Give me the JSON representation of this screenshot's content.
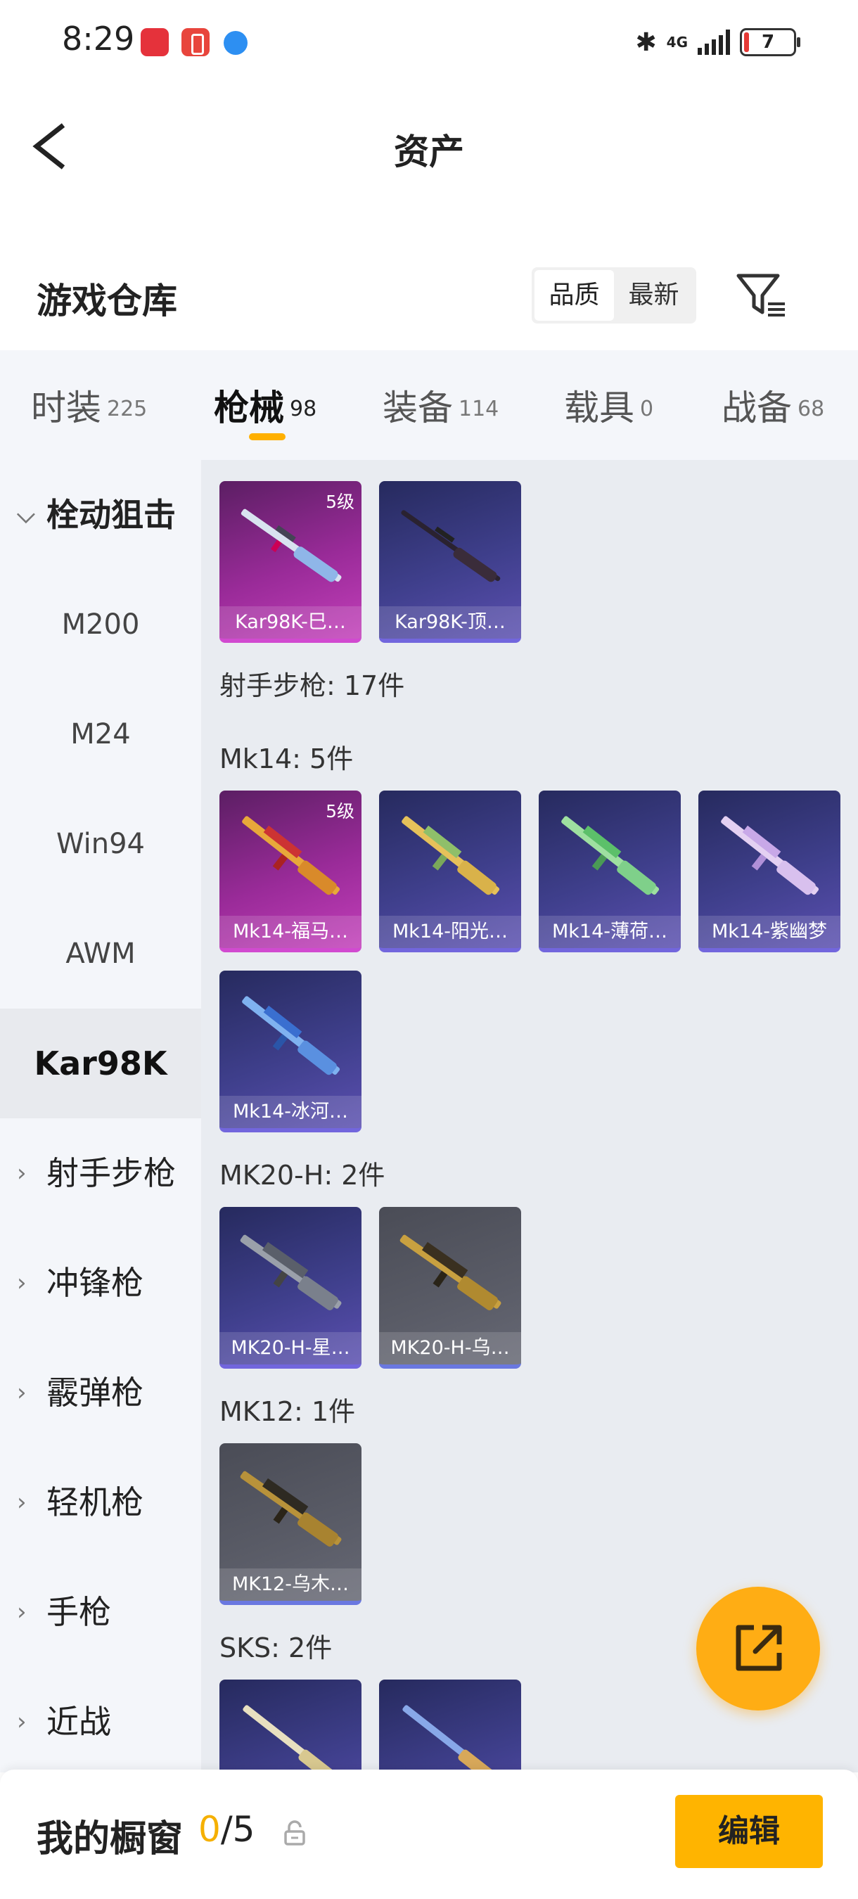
{
  "status_bar": {
    "time": "8:29",
    "network": "4G",
    "battery": "7"
  },
  "header": {
    "title": "资产"
  },
  "warehouse": {
    "title": "游戏仓库",
    "sort_options": [
      "品质",
      "最新"
    ],
    "active_sort": "品质"
  },
  "tabs": [
    {
      "label": "时装",
      "count": "225"
    },
    {
      "label": "枪械",
      "count": "98",
      "active": true
    },
    {
      "label": "装备",
      "count": "114"
    },
    {
      "label": "载具",
      "count": "0"
    },
    {
      "label": "战备",
      "count": "68"
    }
  ],
  "sidebar": {
    "items": [
      {
        "label": "栓动狙击",
        "kind": "category",
        "expanded": true
      },
      {
        "label": "M200",
        "kind": "sub"
      },
      {
        "label": "M24",
        "kind": "sub"
      },
      {
        "label": "Win94",
        "kind": "sub"
      },
      {
        "label": "AWM",
        "kind": "sub"
      },
      {
        "label": "Kar98K",
        "kind": "sub",
        "selected": true
      },
      {
        "label": "射手步枪",
        "kind": "category"
      },
      {
        "label": "冲锋枪",
        "kind": "category"
      },
      {
        "label": "霰弹枪",
        "kind": "category"
      },
      {
        "label": "轻机枪",
        "kind": "category"
      },
      {
        "label": "手枪",
        "kind": "category"
      },
      {
        "label": "近战",
        "kind": "category"
      }
    ]
  },
  "content": {
    "kar98k_cards": [
      {
        "name": "Kar98K-巳…",
        "level": "5级",
        "rarity": "pink"
      },
      {
        "name": "Kar98K-顶…",
        "level": "",
        "rarity": "purple"
      }
    ],
    "groups": [
      {
        "title": "射手步枪: 17件",
        "cards": []
      },
      {
        "title": "Mk14: 5件",
        "cards": [
          {
            "name": "Mk14-福马…",
            "level": "5级",
            "rarity": "pink"
          },
          {
            "name": "Mk14-阳光…",
            "level": "",
            "rarity": "purple"
          },
          {
            "name": "Mk14-薄荷…",
            "level": "",
            "rarity": "purple"
          },
          {
            "name": "Mk14-紫幽梦",
            "level": "",
            "rarity": "purple"
          },
          {
            "name": "Mk14-冰河…",
            "level": "",
            "rarity": "purple"
          }
        ]
      },
      {
        "title": "MK20-H: 2件",
        "cards": [
          {
            "name": "MK20-H-星…",
            "level": "",
            "rarity": "purple"
          },
          {
            "name": "MK20-H-乌…",
            "level": "",
            "rarity": "gray"
          }
        ]
      },
      {
        "title": "MK12: 1件",
        "cards": [
          {
            "name": "MK12-乌木…",
            "level": "",
            "rarity": "gray"
          }
        ]
      },
      {
        "title": "SKS: 2件",
        "cards": [
          {
            "name": "",
            "level": "",
            "rarity": "purple"
          },
          {
            "name": "",
            "level": "",
            "rarity": "purple"
          }
        ]
      }
    ]
  },
  "bottom_bar": {
    "title": "我的橱窗",
    "count_current": "0",
    "count_total": "/5",
    "edit_label": "编辑"
  },
  "icons": {
    "back": "chevron-left-icon",
    "filter": "filter-icon",
    "share": "share-external-icon",
    "lock": "lock-icon"
  },
  "colors": {
    "accent": "#ffb400",
    "rarity_pink": "#d14ad0",
    "rarity_purple": "#7266dd",
    "rarity_gray": "#6a78e0"
  }
}
